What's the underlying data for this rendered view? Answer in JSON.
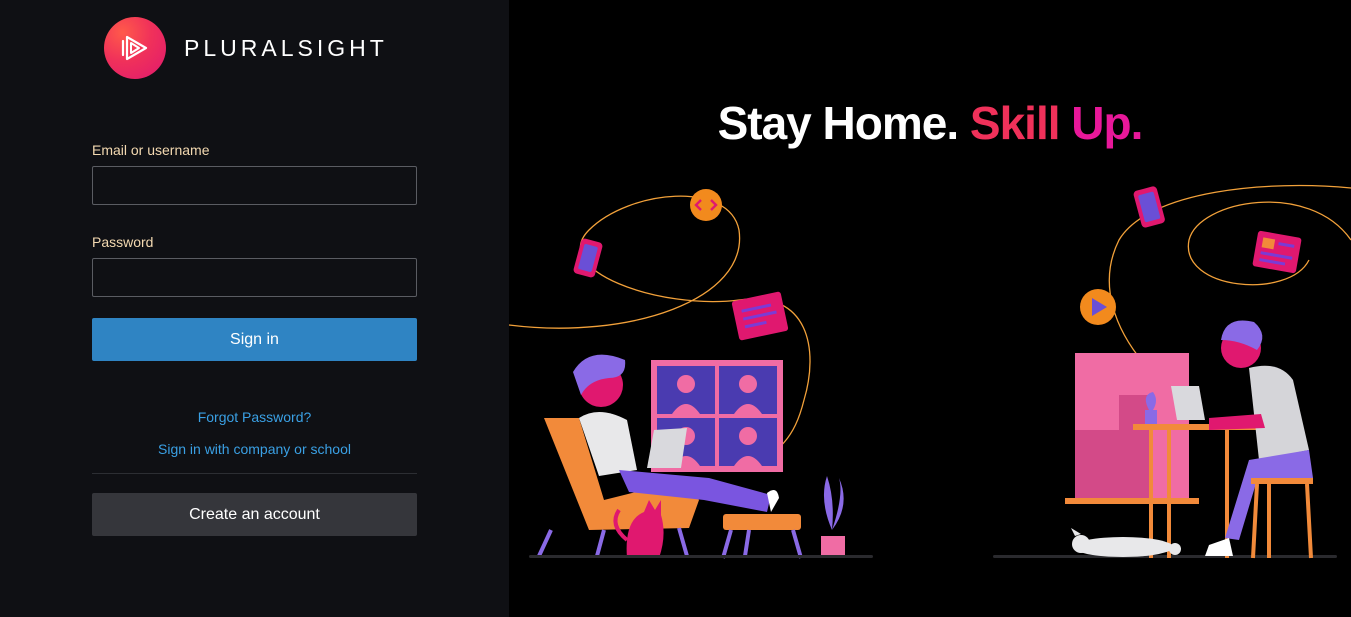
{
  "brand": {
    "name": "PLURALSIGHT"
  },
  "login_form": {
    "email_label": "Email or username",
    "email_value": "",
    "password_label": "Password",
    "password_value": "",
    "signin_label": "Sign in",
    "forgot_password": "Forgot Password?",
    "company_signin": "Sign in with company or school",
    "create_account": "Create an account"
  },
  "promo": {
    "headline_part1": "Stay Home.",
    "headline_part2": "Skill",
    "headline_part3": "Up."
  },
  "colors": {
    "left_bg": "#0f1014",
    "right_bg": "#000000",
    "primary_button": "#2f84c3",
    "secondary_button": "#35363b",
    "link": "#3aa0e4",
    "label": "#f3d9b1",
    "brand_pink": "#f0315a",
    "brand_magenta": "#e8189a"
  },
  "icons": {
    "logo": "play-triangle-icon",
    "illustration": "work-from-home-illustration"
  }
}
